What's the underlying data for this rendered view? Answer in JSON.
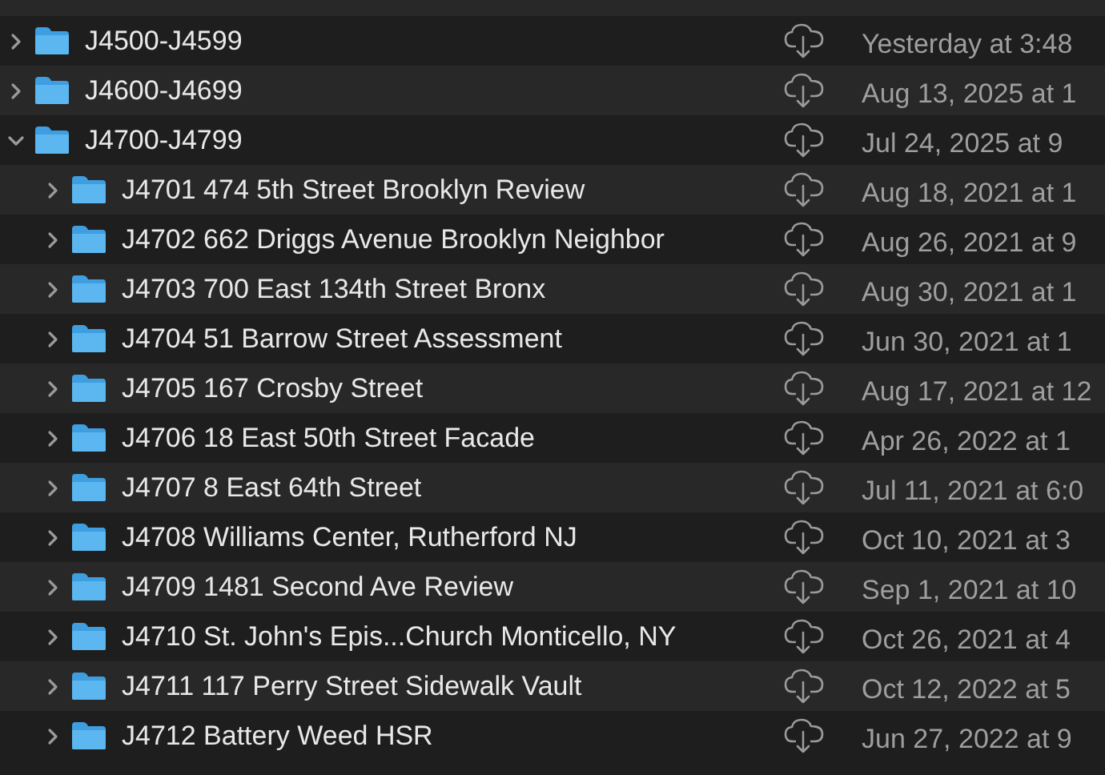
{
  "rows": [
    {
      "name": "J4500-J4599",
      "date": "Yesterday at 3:48",
      "expanded": false
    },
    {
      "name": "J4600-J4699",
      "date": "Aug 13, 2025 at 1",
      "expanded": false
    },
    {
      "name": "J4700-J4799",
      "date": "Jul 24, 2025 at 9",
      "expanded": true,
      "children": [
        {
          "name": "J4701 474 5th Street Brooklyn Review",
          "date": "Aug 18, 2021 at 1",
          "expanded": false
        },
        {
          "name": "J4702 662 Driggs Avenue Brooklyn Neighbor",
          "date": "Aug 26, 2021 at 9",
          "expanded": false
        },
        {
          "name": "J4703 700 East 134th Street Bronx",
          "date": "Aug 30, 2021 at 1",
          "expanded": false
        },
        {
          "name": "J4704 51 Barrow Street Assessment",
          "date": "Jun 30, 2021 at 1",
          "expanded": false
        },
        {
          "name": "J4705 167 Crosby Street",
          "date": "Aug 17, 2021 at 12",
          "expanded": false
        },
        {
          "name": "J4706 18 East 50th Street Facade",
          "date": "Apr 26, 2022 at 1",
          "expanded": false
        },
        {
          "name": "J4707 8 East 64th Street",
          "date": "Jul 11, 2021 at 6:0",
          "expanded": false
        },
        {
          "name": "J4708 Williams Center, Rutherford NJ",
          "date": "Oct 10, 2021 at 3",
          "expanded": false
        },
        {
          "name": "J4709 1481 Second Ave Review",
          "date": "Sep 1, 2021 at 10",
          "expanded": false
        },
        {
          "name": "J4710 St. John's Epis...Church Monticello, NY",
          "date": "Oct 26, 2021 at 4",
          "expanded": false
        },
        {
          "name": "J4711 117 Perry Street Sidewalk Vault",
          "date": "Oct 12, 2022 at 5",
          "expanded": false
        },
        {
          "name": "J4712 Battery Weed HSR",
          "date": "Jun 27, 2022 at 9",
          "expanded": false
        }
      ]
    }
  ]
}
